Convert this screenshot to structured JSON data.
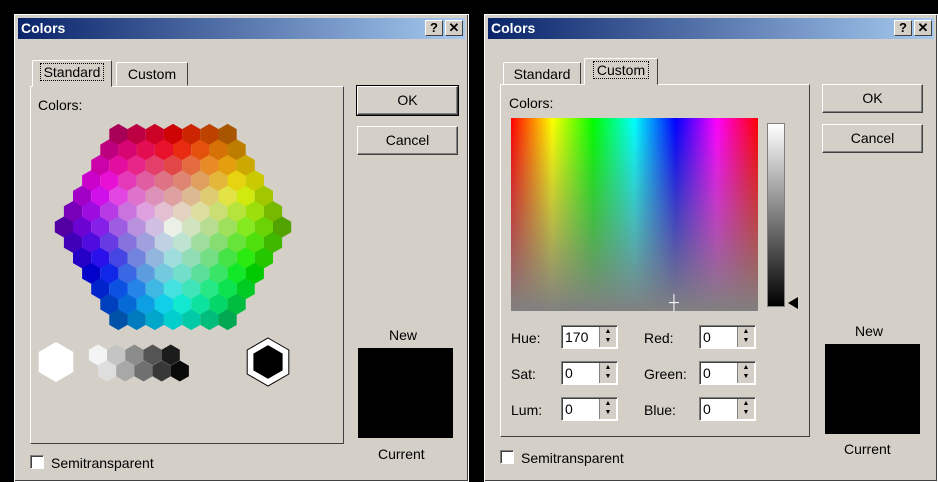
{
  "left_dialog": {
    "title": "Colors",
    "help_button": "?",
    "close_button": "✕",
    "tabs": [
      "Standard",
      "Custom"
    ],
    "colors_label": "Colors:",
    "ok": "OK",
    "cancel": "Cancel",
    "new_label": "New",
    "current_label": "Current",
    "semitransparent": "Semitransparent"
  },
  "right_dialog": {
    "title": "Colors",
    "help_button": "?",
    "close_button": "✕",
    "tabs": [
      "Standard",
      "Custom"
    ],
    "colors_label": "Colors:",
    "ok": "OK",
    "cancel": "Cancel",
    "new_label": "New",
    "current_label": "Current",
    "semitransparent": "Semitransparent",
    "fields": {
      "hue_label": "Hue:",
      "hue": "170",
      "sat_label": "Sat:",
      "sat": "0",
      "lum_label": "Lum:",
      "lum": "0",
      "red_label": "Red:",
      "red": "0",
      "green_label": "Green:",
      "green": "0",
      "blue_label": "Blue:",
      "blue": "0"
    }
  }
}
